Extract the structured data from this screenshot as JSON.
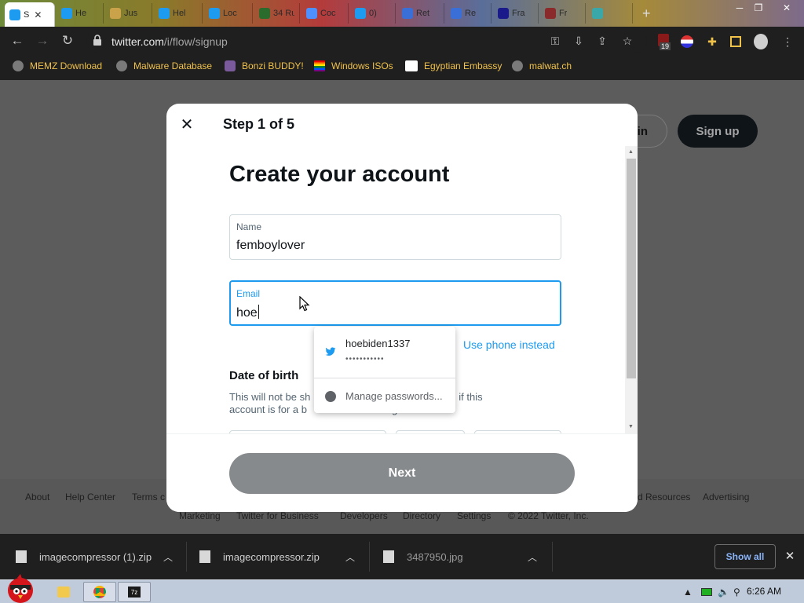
{
  "browser": {
    "tabs": [
      {
        "title": "S",
        "fav": "#1d9bf0",
        "active": true
      },
      {
        "title": "He",
        "fav": "#1d9bf0"
      },
      {
        "title": "Jus",
        "fav": "#c9a24a"
      },
      {
        "title": "Hel",
        "fav": "#1d9bf0"
      },
      {
        "title": "Loc",
        "fav": "#1d9bf0"
      },
      {
        "title": "34 Rul",
        "fav": "#2b6b2b"
      },
      {
        "title": "Coc",
        "fav": "#4d90fe"
      },
      {
        "title": "0)",
        "fav": "#1d9bf0"
      },
      {
        "title": "Ret",
        "fav": "#3a6fd8"
      },
      {
        "title": "Re",
        "fav": "#3a6fd8"
      },
      {
        "title": "Fra",
        "fav": "#1a1a8a"
      },
      {
        "title": "Fr",
        "fav": "#8a2a2a"
      },
      {
        "title": "",
        "fav": "#3aa8a8"
      }
    ],
    "url_host": "twitter.com",
    "url_path": "/i/flow/signup",
    "ext_badge": "19",
    "bookmarks": [
      "MEMZ Download",
      "Malware Database",
      "Bonzi BUDDY!",
      "Windows ISOs",
      "Egyptian Embassy",
      "malwat.ch"
    ]
  },
  "page": {
    "login_label": "in",
    "signup_label": "Sign up",
    "footer_row1": [
      "About",
      "Help Center",
      "Terms c",
      "d Resources",
      "Advertising"
    ],
    "footer_row2": [
      "Marketing",
      "Twitter for Business",
      "Developers",
      "Directory",
      "Settings",
      "© 2022 Twitter, Inc."
    ]
  },
  "modal": {
    "step": "Step 1 of 5",
    "heading": "Create your account",
    "name_label": "Name",
    "name_value": "femboylover",
    "email_label": "Email",
    "email_value": "hoe",
    "use_phone": "Use phone instead",
    "dob_title": "Date of birth",
    "dob_text_line1": "This will not be sh",
    "dob_text_line1b": "wn age, even if this",
    "dob_text_line2": "account is for a b",
    "dob_text_line2b": "g else.",
    "next_label": "Next"
  },
  "autofill": {
    "username": "hoebiden1337",
    "password_mask": "•••••••••••",
    "manage_label": "Manage passwords..."
  },
  "downloads": {
    "items": [
      "imagecompressor (1).zip",
      "imagecompressor.zip",
      "3487950.jpg"
    ],
    "show_all": "Show all"
  },
  "taskbar": {
    "clock": "6:26 AM"
  }
}
